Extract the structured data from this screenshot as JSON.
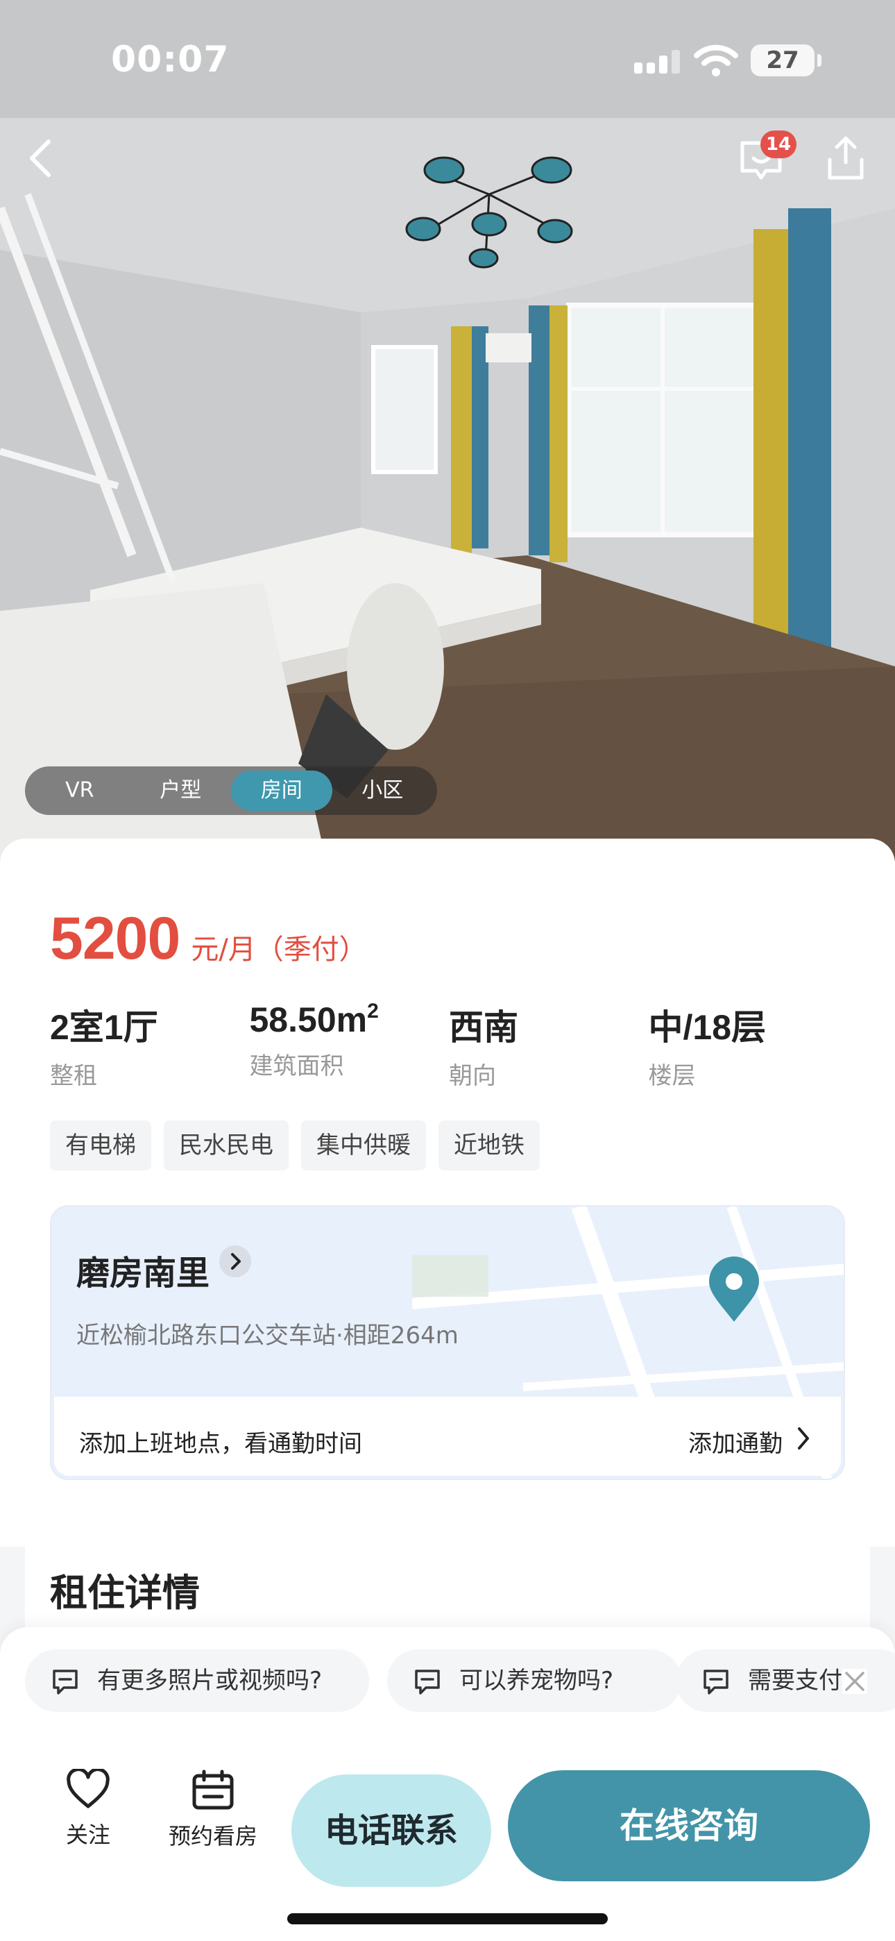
{
  "status_bar": {
    "time": "00:07",
    "battery": "27"
  },
  "header": {
    "message_badge": "14"
  },
  "media_tabs": [
    {
      "label": "VR"
    },
    {
      "label": "户型"
    },
    {
      "label": "房间"
    },
    {
      "label": "小区"
    }
  ],
  "listing": {
    "price": "5200",
    "price_unit": "元/月（季付）",
    "specs": [
      {
        "value": "2室1厅",
        "label": "整租"
      },
      {
        "value": "58.50m",
        "label": "建筑面积"
      },
      {
        "value": "西南",
        "label": "朝向"
      },
      {
        "value": "中/18层",
        "label": "楼层"
      }
    ],
    "area_superscript": "2",
    "tags": [
      "有电梯",
      "民水民电",
      "集中供暖",
      "近地铁"
    ]
  },
  "community": {
    "name": "磨房南里",
    "transit": "近松榆北路东口公交车站·相距264m",
    "commute_prompt": "添加上班地点，看通勤时间",
    "commute_link": "添加通勤"
  },
  "detail": {
    "title": "租住详情"
  },
  "quick_questions": [
    "有更多照片或视频吗?",
    "可以养宠物吗?",
    "需要支付"
  ],
  "actions": {
    "follow": "关注",
    "schedule": "预约看房",
    "call": "电话联系",
    "consult": "在线咨询"
  },
  "colors": {
    "price": "#e24e3f",
    "accent": "#4394a8",
    "call_bg": "#bde8ee",
    "badge": "#e4514a"
  }
}
